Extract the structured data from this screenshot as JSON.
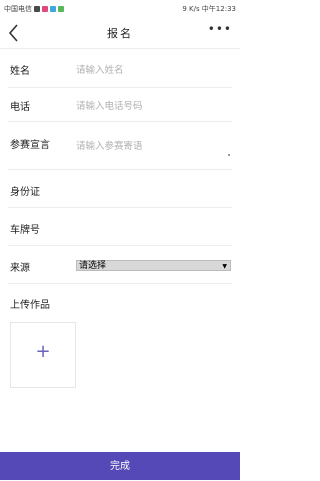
{
  "status_bar": {
    "left": "中国电信",
    "right": "9 K/s  中午12:33"
  },
  "nav": {
    "title": "报名",
    "more": "•••"
  },
  "form": {
    "name": {
      "label": "姓名",
      "placeholder": "请输入姓名"
    },
    "phone": {
      "label": "电话",
      "placeholder": "请输入电话号码"
    },
    "declaration": {
      "label": "参赛宣言",
      "placeholder": "请输入参赛寄语"
    },
    "id_card": {
      "label": "身份证"
    },
    "plate": {
      "label": "车牌号"
    },
    "source": {
      "label": "来源",
      "selected": "请选择"
    },
    "upload": {
      "label": "上传作品",
      "icon": "+"
    }
  },
  "footer": {
    "submit_label": "完成"
  }
}
